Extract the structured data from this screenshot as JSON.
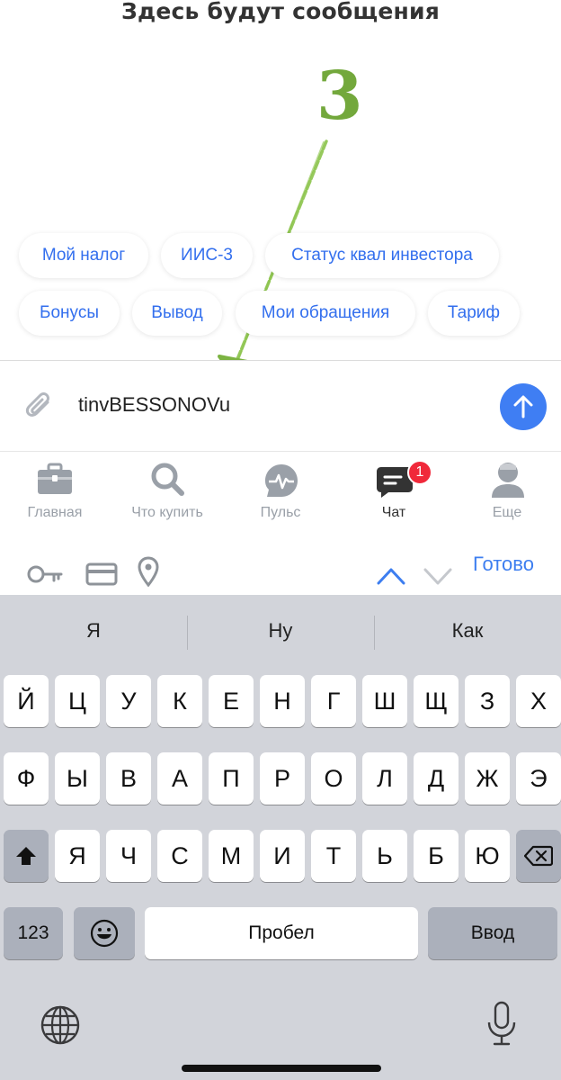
{
  "header": {
    "title": "Здесь будут сообщения"
  },
  "annotation": {
    "step_number": "3",
    "color": "#73a83c"
  },
  "chips": [
    {
      "label": "Мой налог"
    },
    {
      "label": "ИИС-3"
    },
    {
      "label": "Статус квал инвестора"
    },
    {
      "label": "Бонусы"
    },
    {
      "label": "Вывод"
    },
    {
      "label": "Мои обращения"
    },
    {
      "label": "Тариф"
    }
  ],
  "input": {
    "value": "tinvBESSONOVu",
    "attach_icon": "paperclip-icon",
    "send_icon": "arrow-up-icon"
  },
  "tabs": [
    {
      "label": "Главная",
      "icon": "briefcase-icon"
    },
    {
      "label": "Что купить",
      "icon": "search-icon"
    },
    {
      "label": "Пульс",
      "icon": "pulse-icon"
    },
    {
      "label": "Чат",
      "icon": "chat-icon",
      "badge": "1",
      "active": true
    },
    {
      "label": "Еще",
      "icon": "person-icon"
    }
  ],
  "accessory": {
    "done_label": "Готово"
  },
  "keyboard": {
    "suggestions": [
      "Я",
      "Ну",
      "Как"
    ],
    "row1": [
      "Й",
      "Ц",
      "У",
      "К",
      "Е",
      "Н",
      "Г",
      "Ш",
      "Щ",
      "З",
      "Х"
    ],
    "row2": [
      "Ф",
      "Ы",
      "В",
      "А",
      "П",
      "Р",
      "О",
      "Л",
      "Д",
      "Ж",
      "Э"
    ],
    "row3": [
      "Я",
      "Ч",
      "С",
      "М",
      "И",
      "Т",
      "Ь",
      "Б",
      "Ю"
    ],
    "numbers_label": "123",
    "space_label": "Пробел",
    "return_label": "Ввод"
  },
  "colors": {
    "accent": "#3f7ef3",
    "badge": "#f0293a",
    "link": "#336fee"
  }
}
